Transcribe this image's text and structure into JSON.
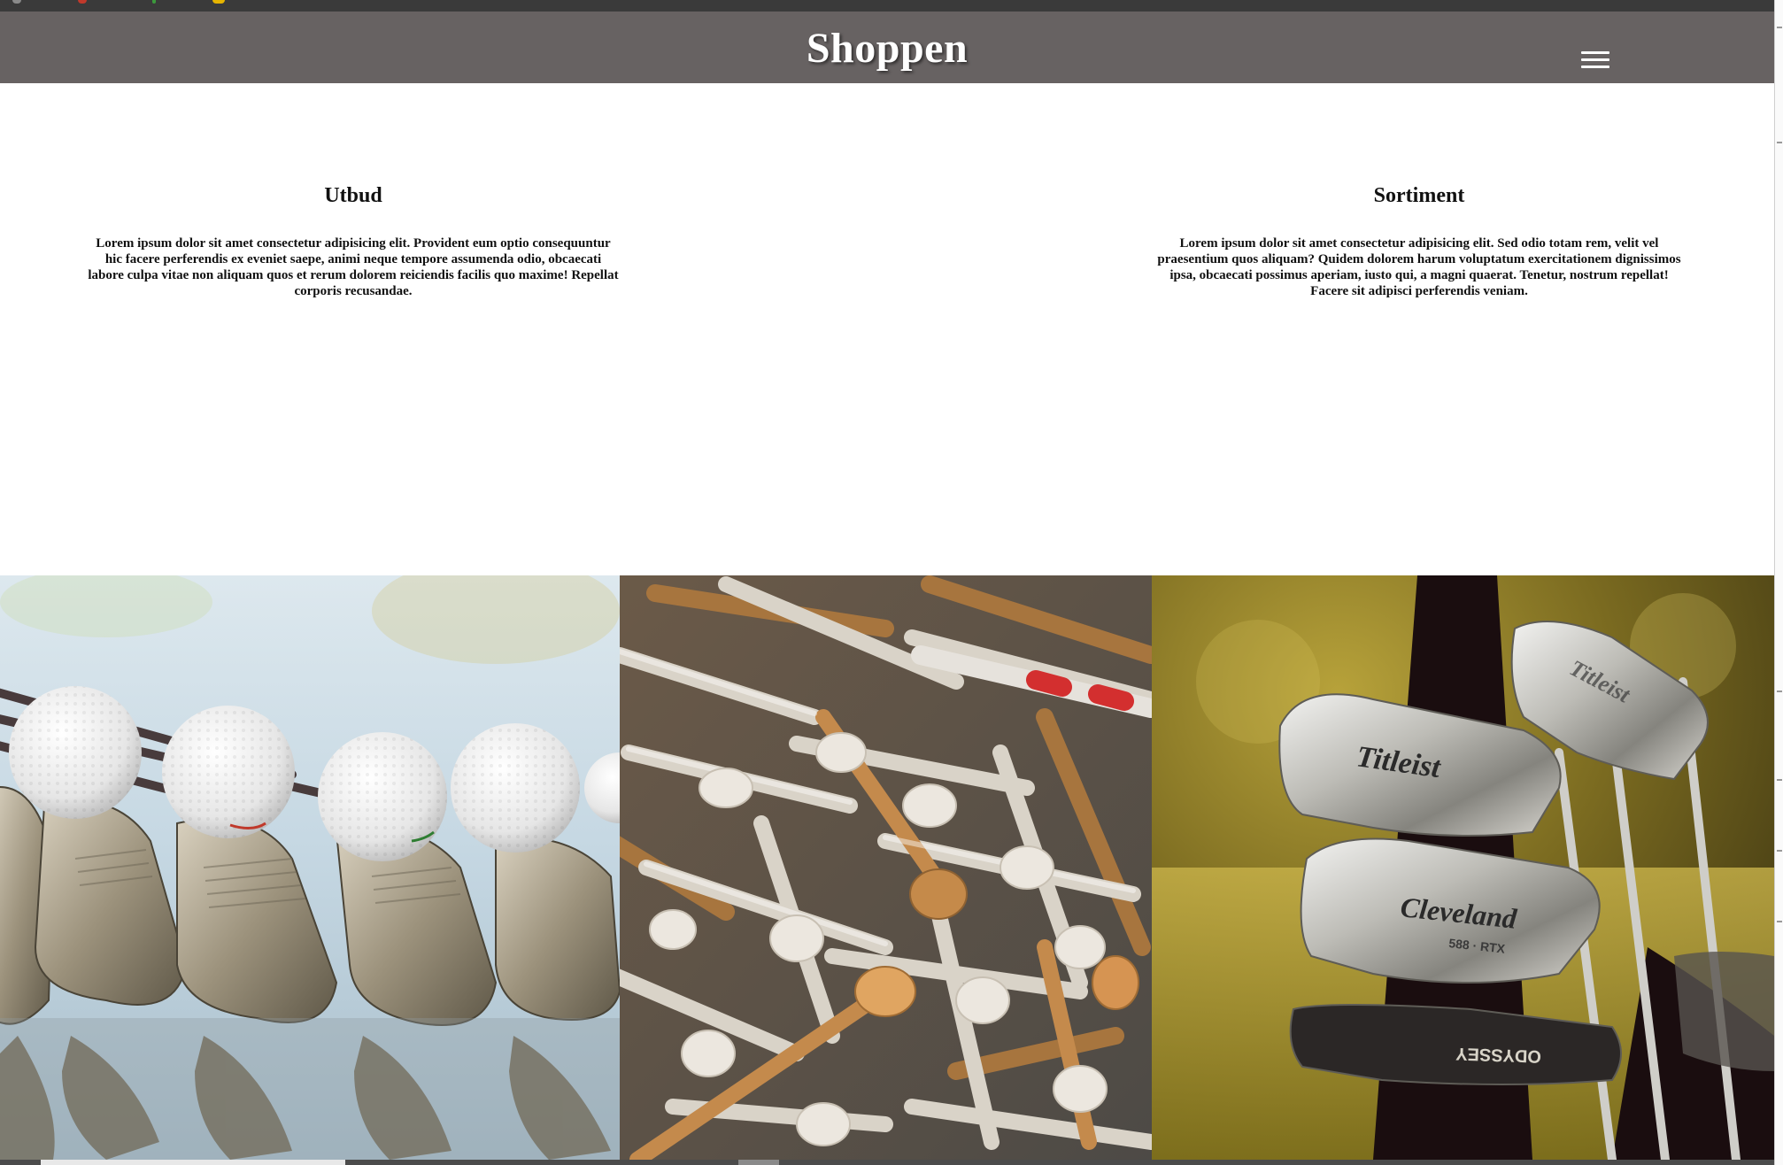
{
  "navbar": {
    "brand": "Shoppen",
    "menu_icon": "hamburger-menu-icon"
  },
  "sections": [
    {
      "heading": "Utbud",
      "text": "Lorem ipsum dolor sit amet consectetur adipisicing elit. Provident eum optio consequuntur hic facere perferendis ex eveniet saepe, animi neque tempore assumenda odio, obcaecati labore culpa vitae non aliquam quos et rerum dolorem reiciendis facilis quo maxime! Repellat corporis recusandae."
    },
    {
      "heading": "Sortiment",
      "text": "Lorem ipsum dolor sit amet consectetur adipisicing elit. Sed odio totam rem, velit vel praesentium quos aliquam? Quidem dolorem harum voluptatum exercitationem dignissimos ipsa, obcaecati possimus aperiam, iusto qui, a magni quaerat. Tenetur, nostrum repellat! Facere sit adipisci perferendis veniam."
    }
  ],
  "gallery": {
    "images": [
      {
        "subject": "golf-balls-on-irons"
      },
      {
        "subject": "golf-tees-pile"
      },
      {
        "subject": "golf-clubs-in-bag",
        "club_texts": [
          "Titleist",
          "Cleveland",
          "588 · RTX",
          "ODYSSEY"
        ]
      }
    ]
  },
  "colors": {
    "navbar": "#676262",
    "brand_text": "#ffffff",
    "body_text": "#111111"
  }
}
